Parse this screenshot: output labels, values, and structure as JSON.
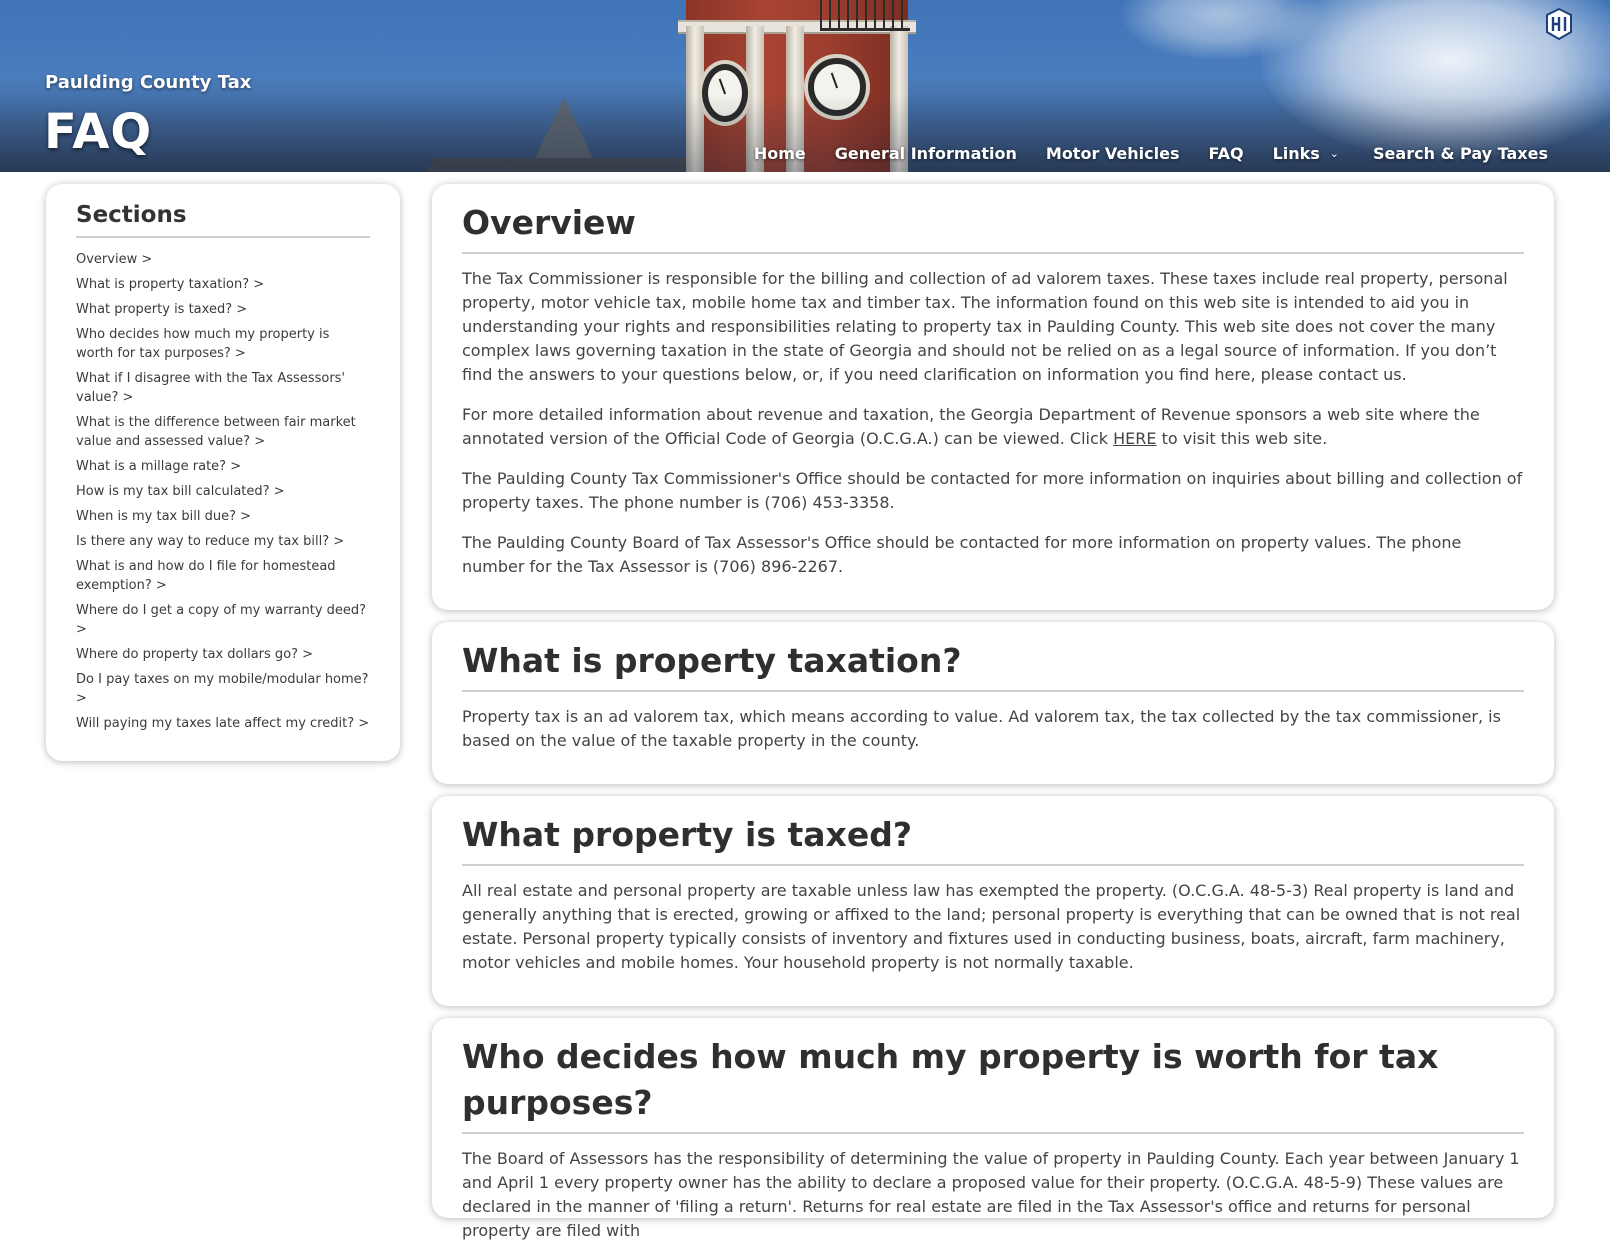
{
  "header": {
    "site_name": "Paulding County Tax",
    "page_title": "FAQ",
    "logo_icon": "shield-logo-icon",
    "nav": [
      {
        "label": "Home"
      },
      {
        "label": "General Information"
      },
      {
        "label": "Motor Vehicles"
      },
      {
        "label": "FAQ"
      },
      {
        "label": "Links",
        "caret": "⌄"
      },
      {
        "label": "Search & Pay Taxes"
      }
    ]
  },
  "sidebar": {
    "title": "Sections",
    "items": [
      {
        "label": "Overview >"
      },
      {
        "label": "What is property taxation? >"
      },
      {
        "label": "What property is taxed? >"
      },
      {
        "label": "Who decides how much my property is worth for tax purposes? >"
      },
      {
        "label": "What if I disagree with the Tax Assessors' value? >"
      },
      {
        "label": "What is the difference between fair market value and assessed value? >"
      },
      {
        "label": "What is a millage rate? >"
      },
      {
        "label": "How is my tax bill calculated? >"
      },
      {
        "label": "When is my tax bill due? >"
      },
      {
        "label": "Is there any way to reduce my tax bill? >"
      },
      {
        "label": "What is and how do I file for homestead exemption? >"
      },
      {
        "label": "Where do I get a copy of my warranty deed? >"
      },
      {
        "label": "Where do property tax dollars go? >"
      },
      {
        "label": "Do I pay taxes on my mobile/modular home? >"
      },
      {
        "label": "Will paying my taxes late affect my credit? >"
      }
    ]
  },
  "sections": {
    "overview": {
      "title": "Overview",
      "p1": "The Tax Commissioner is responsible for the billing and collection of ad valorem taxes. These taxes include real property, personal property, motor vehicle tax, mobile home tax and timber tax. The information found on this web site is intended to aid you in understanding your rights and responsibilities relating to property tax in Paulding County. This web site does not cover the many complex laws governing taxation in the state of Georgia and should not be relied on as a legal source of information. If you don’t find the answers to your questions below, or, if you need clarification on information you find here, please contact us.",
      "p2_before": "For more detailed information about revenue and taxation, the Georgia Department of Revenue sponsors a web site where the annotated version of the Official Code of Georgia (O.C.G.A.) can be viewed. Click ",
      "p2_link": "HERE",
      "p2_after": " to visit this web site.",
      "p3": "The Paulding County Tax Commissioner's Office should be contacted for more information on inquiries about billing and collection of property taxes. The phone number is (706) 453-3358.",
      "p4": "The Paulding County Board of Tax Assessor's Office should be contacted for more information on property values. The phone number for the Tax Assessor is (706) 896-2267."
    },
    "taxation": {
      "title": "What is property taxation?",
      "p1": "Property tax is an ad valorem tax, which means according to value. Ad valorem tax, the tax collected by the tax commissioner, is based on the value of the taxable property in the county."
    },
    "taxed": {
      "title": "What property is taxed?",
      "p1": "All real estate and personal property are taxable unless law has exempted the property. (O.C.G.A. 48-5-3) Real property is land and generally anything that is erected, growing or affixed to the land; personal property is everything that can be owned that is not real estate. Personal property typically consists of inventory and fixtures used in conducting business, boats, aircraft, farm machinery, motor vehicles and mobile homes. Your household property is not normally taxable."
    },
    "who_decides": {
      "title": "Who decides how much my property is worth for tax purposes?",
      "p1": "The Board of Assessors has the responsibility of determining the value of property in Paulding County. Each year between January 1 and April 1 every property owner has the ability to declare a proposed value for their property. (O.C.G.A. 48-5-9) These values are declared in the manner of 'filing a return'. Returns for real estate are filed in the Tax Assessor's office and returns for personal property are filed with"
    }
  }
}
